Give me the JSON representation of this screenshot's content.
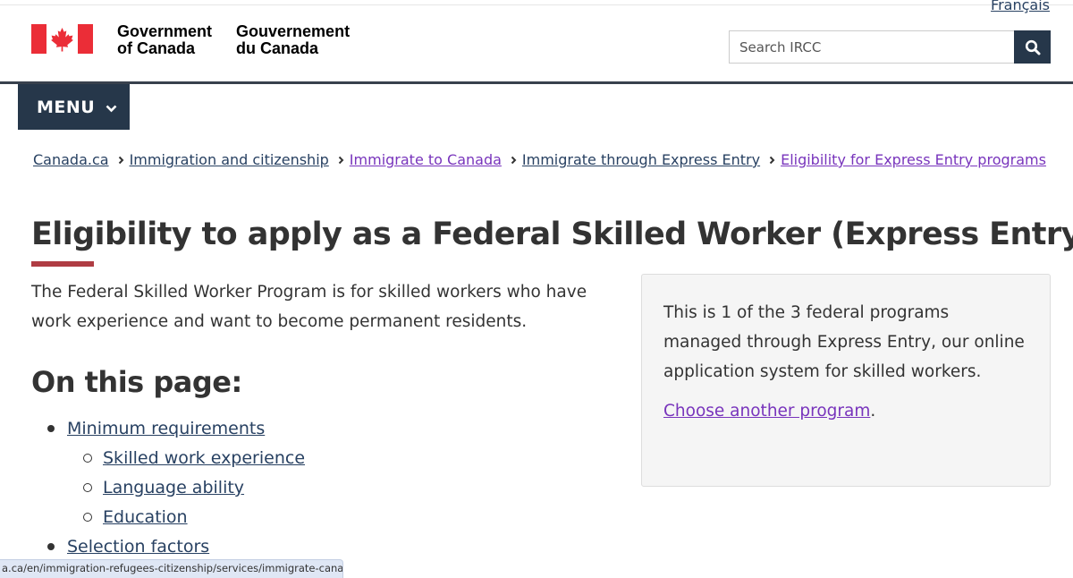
{
  "header": {
    "language_link": "Français",
    "signature_en_line1": "Government",
    "signature_en_line2": "of Canada",
    "signature_fr_line1": "Gouvernement",
    "signature_fr_line2": "du Canada",
    "search_placeholder": "Search IRCC",
    "menu_label": "MENU"
  },
  "breadcrumb": [
    {
      "label": "Canada.ca",
      "visited": false
    },
    {
      "label": "Immigration and citizenship",
      "visited": false
    },
    {
      "label": "Immigrate to Canada",
      "visited": true
    },
    {
      "label": "Immigrate through Express Entry",
      "visited": false
    },
    {
      "label": "Eligibility for Express Entry programs",
      "visited": true
    }
  ],
  "main": {
    "title": "Eligibility to apply as a Federal Skilled Worker (Express Entry)",
    "intro": "The Federal Skilled Worker Program is for skilled workers who have work experience and want to become permanent residents.",
    "toc_heading": "On this page:",
    "toc": {
      "item1": "Minimum requirements",
      "sub1": "Skilled work experience",
      "sub2": "Language ability",
      "sub3": "Education",
      "item2": "Selection factors"
    }
  },
  "panel": {
    "text": "This is 1 of the 3 federal programs managed through Express Entry, our online application system for skilled workers.",
    "link": "Choose another program",
    "link_suffix": "."
  },
  "status_bar": {
    "url": "a.ca/en/immigration-refugees-citizenship/services/immigrate-canada...."
  },
  "colors": {
    "brand_dark": "#26374a",
    "link": "#284162",
    "visited": "#7834bc",
    "accent_red": "#af3c43",
    "flag_red": "#eb2d37"
  },
  "icons": {
    "flag": "canada-flag-icon",
    "search": "search-icon",
    "menu_chevron": "chevron-down-icon",
    "breadcrumb_separator": "chevron-right-icon"
  }
}
